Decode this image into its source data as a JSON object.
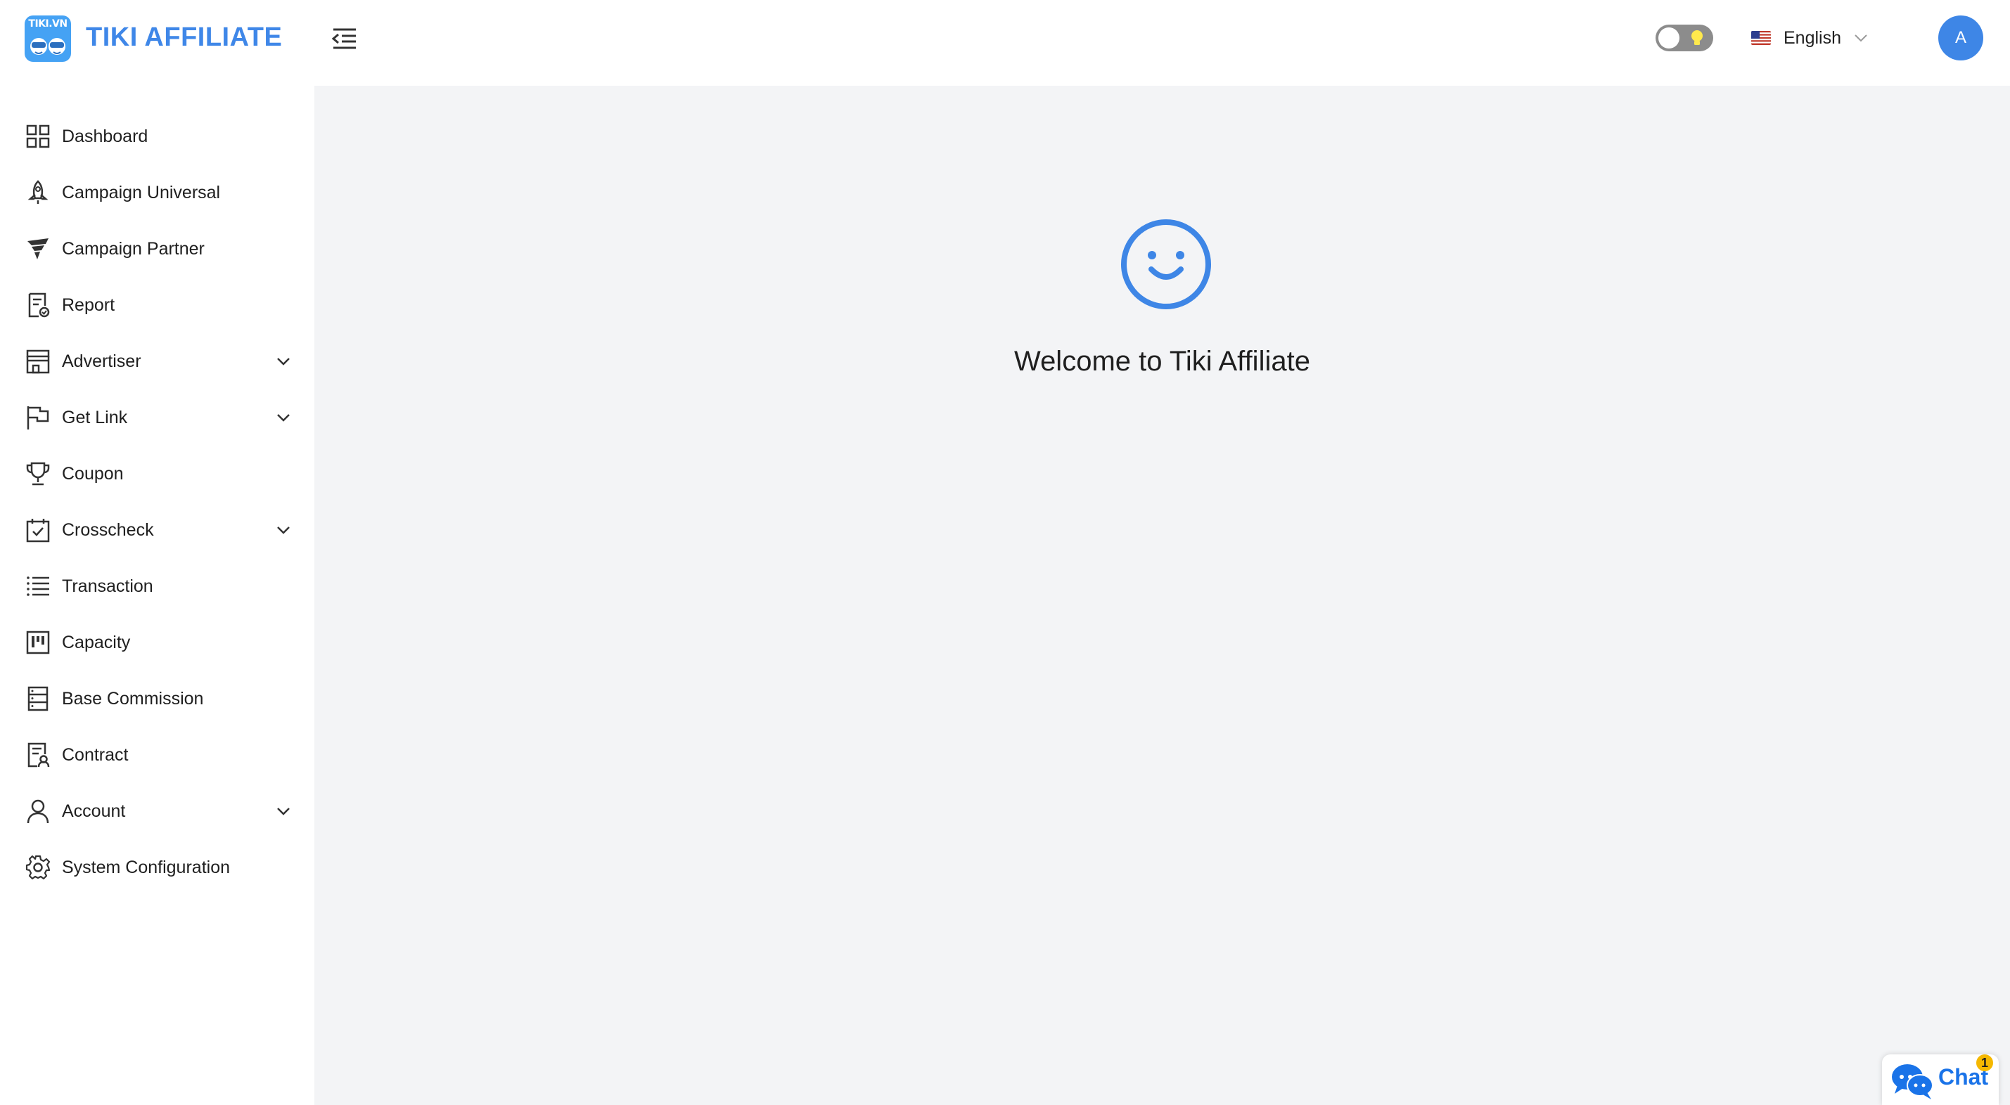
{
  "header": {
    "logo_text": "TIKI.VN",
    "brand": "TIKI AFFILIATE",
    "collapse_icon": "menu-fold-icon",
    "theme_toggle_icon": "lightbulb-icon",
    "language": {
      "flag": "us-flag-icon",
      "label": "English"
    },
    "avatar_initial": "A"
  },
  "sidebar": {
    "items": [
      {
        "label": "Dashboard",
        "icon": "dashboard-icon",
        "has_submenu": false
      },
      {
        "label": "Campaign Universal",
        "icon": "rocket-icon",
        "has_submenu": false
      },
      {
        "label": "Campaign Partner",
        "icon": "wing-icon",
        "has_submenu": false
      },
      {
        "label": "Report",
        "icon": "report-icon",
        "has_submenu": false
      },
      {
        "label": "Advertiser",
        "icon": "shop-icon",
        "has_submenu": true
      },
      {
        "label": "Get Link",
        "icon": "flag-icon",
        "has_submenu": true
      },
      {
        "label": "Coupon",
        "icon": "trophy-icon",
        "has_submenu": false
      },
      {
        "label": "Crosscheck",
        "icon": "calendar-check-icon",
        "has_submenu": true
      },
      {
        "label": "Transaction",
        "icon": "list-icon",
        "has_submenu": false
      },
      {
        "label": "Capacity",
        "icon": "project-icon",
        "has_submenu": false
      },
      {
        "label": "Base Commission",
        "icon": "database-icon",
        "has_submenu": false
      },
      {
        "label": "Contract",
        "icon": "contract-icon",
        "has_submenu": false
      },
      {
        "label": "Account",
        "icon": "user-icon",
        "has_submenu": true
      },
      {
        "label": "System Configuration",
        "icon": "gear-icon",
        "has_submenu": false
      }
    ]
  },
  "main": {
    "icon": "smile-icon",
    "welcome": "Welcome to Tiki Affiliate"
  },
  "chat": {
    "label": "Chat",
    "badge": "1",
    "icon": "chat-bubbles-icon"
  },
  "colors": {
    "brand": "#3f87e8",
    "accent": "#3e86e6",
    "content_bg": "#f3f4f6"
  }
}
